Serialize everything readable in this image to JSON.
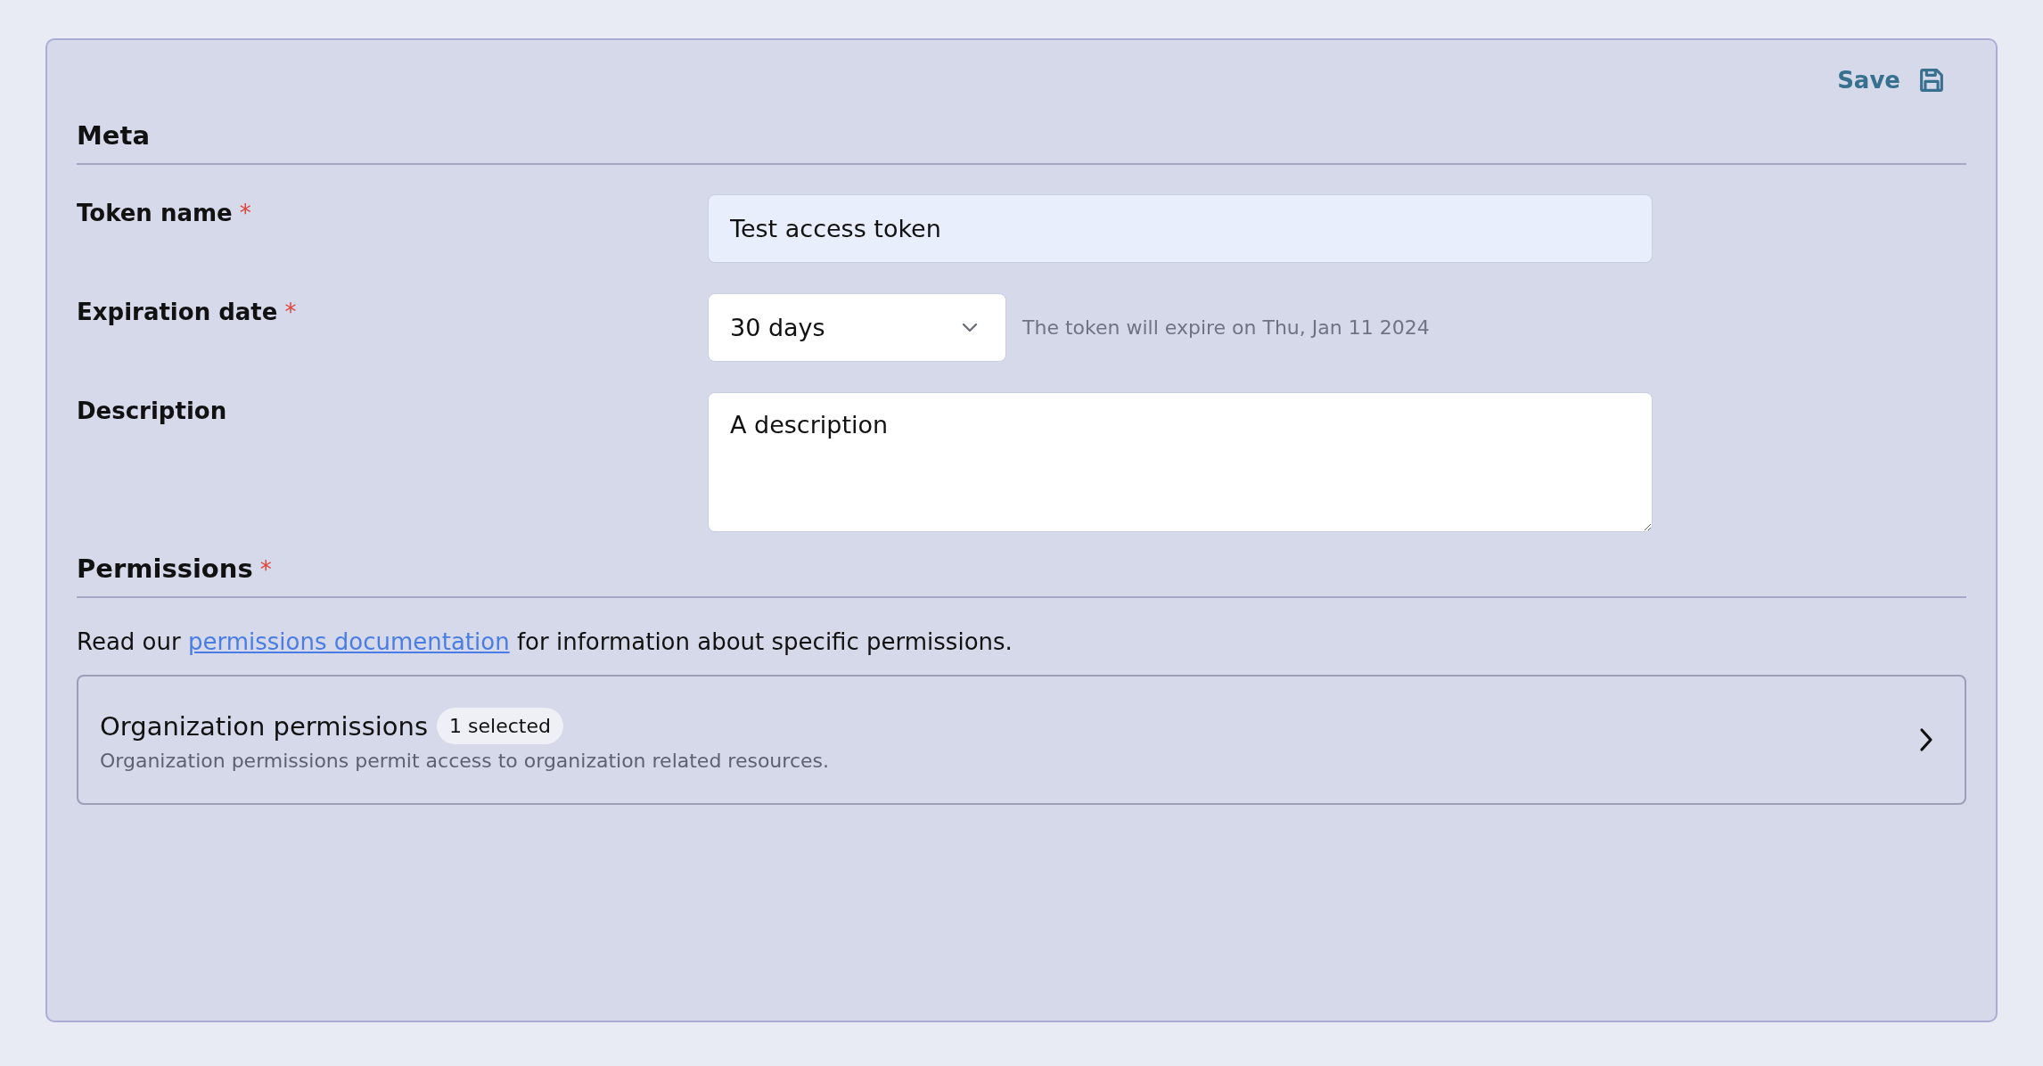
{
  "toolbar": {
    "save_label": "Save"
  },
  "meta_section": {
    "title": "Meta",
    "fields": [
      {
        "kind": "text",
        "label": "Token name",
        "required_mark": "*",
        "value": "Test access token"
      },
      {
        "kind": "select",
        "label": "Expiration date",
        "required_mark": "*",
        "value": "30 days",
        "hint": "The token will expire on Thu, Jan 11 2024"
      },
      {
        "kind": "textarea",
        "label": "Description",
        "value": "A description"
      }
    ]
  },
  "permissions_section": {
    "title": "Permissions",
    "required_mark": "*",
    "intro": {
      "before": "Read our",
      "link": "permissions documentation",
      "after": "for information about specific permissions."
    },
    "groups": [
      {
        "title": "Organization permissions",
        "badge": "1 selected",
        "description": "Organization permissions permit access to organization related resources."
      }
    ]
  }
}
